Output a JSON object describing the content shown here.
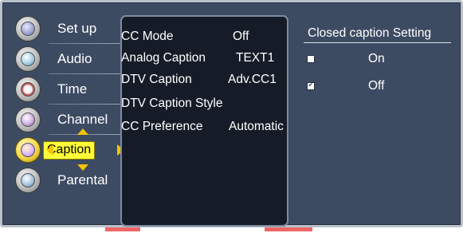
{
  "menu": {
    "items": [
      {
        "label": "Set up"
      },
      {
        "label": "Audio"
      },
      {
        "label": "Time"
      },
      {
        "label": "Channel"
      },
      {
        "label": "Caption",
        "selected": true
      },
      {
        "label": "Parental"
      }
    ]
  },
  "options": [
    {
      "name": "CC Mode",
      "value": "Off"
    },
    {
      "name": "Analog Caption",
      "value": "TEXT1"
    },
    {
      "name": "DTV Caption",
      "value": "Adv.CC1"
    },
    {
      "name": "DTV Caption Style",
      "value": ""
    },
    {
      "name": "CC Preference",
      "value": "Automatic"
    }
  ],
  "submenu": {
    "title": "Closed caption Setting",
    "choices": [
      {
        "label": "On",
        "checked": false
      },
      {
        "label": "Off",
        "checked": true
      }
    ]
  },
  "colors": {
    "background": "#3d4b62",
    "highlight": "#fffb38",
    "arrow": "#f4c400",
    "panel": "#161c27"
  }
}
